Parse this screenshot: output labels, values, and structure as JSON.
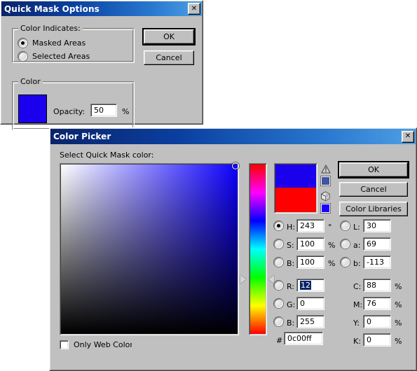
{
  "quick_mask": {
    "title": "Quick Mask Options",
    "close_label": "✕",
    "buttons": {
      "ok": "OK",
      "cancel": "Cancel"
    },
    "color_indicates": {
      "legend": "Color Indicates:",
      "options": [
        {
          "label": "Masked Areas",
          "selected": true
        },
        {
          "label": "Selected Areas",
          "selected": false
        }
      ]
    },
    "color_group": {
      "legend": "Color",
      "swatch_hex": "#1a00ec",
      "opacity_label": "Opacity:",
      "opacity_value": "50",
      "percent": "%"
    }
  },
  "color_picker": {
    "title": "Color Picker",
    "close_label": "✕",
    "prompt": "Select Quick Mask color:",
    "buttons": {
      "ok": "OK",
      "cancel": "Cancel",
      "libraries": "Color Libraries"
    },
    "preview": {
      "new_hex": "#1a00ec",
      "current_hex": "#fe0000",
      "gamut_warning_icon": "warning-triangle-icon",
      "gamut_alt_hex": "#4055a0",
      "web_safe_icon": "cube-icon",
      "web_safe_hex": "#1a00ff"
    },
    "field": {
      "hue_deg": 243,
      "marker_x_pct": 99,
      "marker_y_pct": 1
    },
    "hue_slider": {
      "value_pct": 67.5
    },
    "only_web_colors": {
      "label": "Only Web Colors",
      "checked": false
    },
    "hex": {
      "label": "#",
      "value": "0c00ff"
    },
    "hsb": [
      {
        "name": "H",
        "label": "H:",
        "value": "243",
        "unit": "°",
        "selected": true
      },
      {
        "name": "S",
        "label": "S:",
        "value": "100",
        "unit": "%",
        "selected": false
      },
      {
        "name": "B",
        "label": "B:",
        "value": "100",
        "unit": "%",
        "selected": false
      }
    ],
    "rgb": [
      {
        "name": "R",
        "label": "R:",
        "value": "12",
        "unit": "",
        "selected": false,
        "highlighted": true
      },
      {
        "name": "G",
        "label": "G:",
        "value": "0",
        "unit": "",
        "selected": false,
        "highlighted": false
      },
      {
        "name": "B",
        "label": "B:",
        "value": "255",
        "unit": "",
        "selected": false,
        "highlighted": false
      }
    ],
    "lab": [
      {
        "name": "L",
        "label": "L:",
        "value": "30",
        "unit": "",
        "selected": false
      },
      {
        "name": "a",
        "label": "a:",
        "value": "69",
        "unit": "",
        "selected": false
      },
      {
        "name": "b",
        "label": "b:",
        "value": "-113",
        "unit": "",
        "selected": false
      }
    ],
    "cmyk": [
      {
        "name": "C",
        "label": "C:",
        "value": "88",
        "unit": "%"
      },
      {
        "name": "M",
        "label": "M:",
        "value": "76",
        "unit": "%"
      },
      {
        "name": "Y",
        "label": "Y:",
        "value": "0",
        "unit": "%"
      },
      {
        "name": "K",
        "label": "K:",
        "value": "0",
        "unit": "%"
      }
    ]
  }
}
